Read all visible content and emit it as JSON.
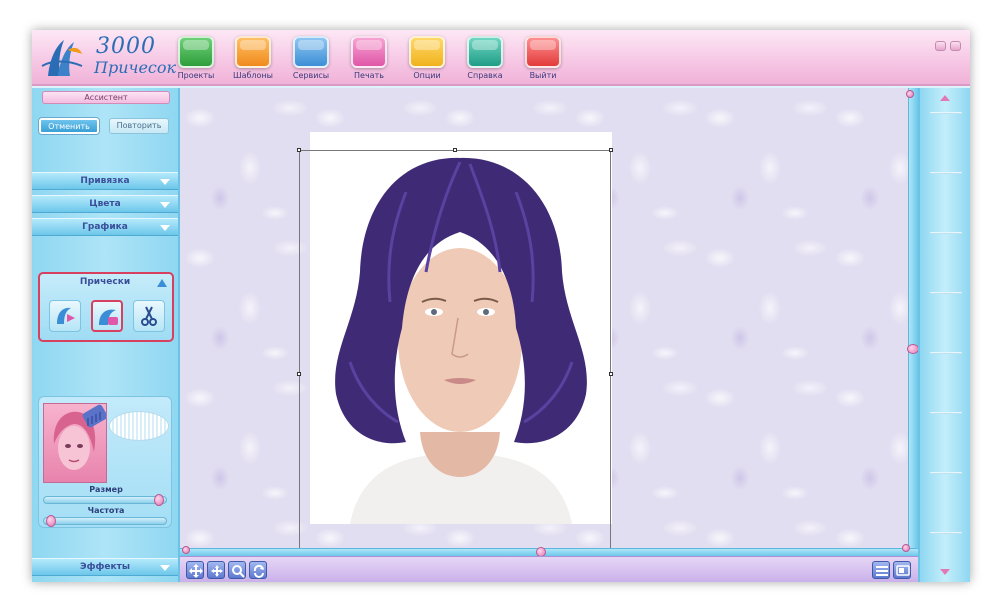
{
  "app": {
    "logo_number": "3000",
    "logo_word": "Причесок"
  },
  "toolbar": {
    "items": [
      {
        "label": "Проекты",
        "icon": "folder-icon",
        "color": "#2e9e3a"
      },
      {
        "label": "Шаблоны",
        "icon": "templates-icon",
        "color": "#f08a1c"
      },
      {
        "label": "Сервисы",
        "icon": "scissors-icon",
        "color": "#3b8ed6"
      },
      {
        "label": "Печать",
        "icon": "printer-icon",
        "color": "#e056a8"
      },
      {
        "label": "Опции",
        "icon": "options-gear-icon",
        "color": "#f0b21c"
      },
      {
        "label": "Справка",
        "icon": "help-question-icon",
        "color": "#1f9c86"
      },
      {
        "label": "Выйти",
        "icon": "exit-hand-icon",
        "color": "#e23a3a"
      }
    ]
  },
  "sidebar": {
    "assistant_label": "Ассистент",
    "undo_label": "Отменить",
    "redo_label": "Повторить",
    "sections": [
      "Привязка",
      "Цвета",
      "Графика"
    ],
    "hairstyles": {
      "title": "Прически",
      "tools": [
        "hairstyle-add-icon",
        "hairstyle-edit-icon",
        "hair-scissors-icon"
      ]
    },
    "preview": {
      "size_label": "Размер",
      "frequency_label": "Частота"
    },
    "effects_label": "Эффекты"
  },
  "colors": {
    "accent_pink": "#f0b2d8",
    "panel_blue": "#8fd7f1",
    "selection_red": "#d8405f",
    "hair_purple": "#3f2a75"
  }
}
